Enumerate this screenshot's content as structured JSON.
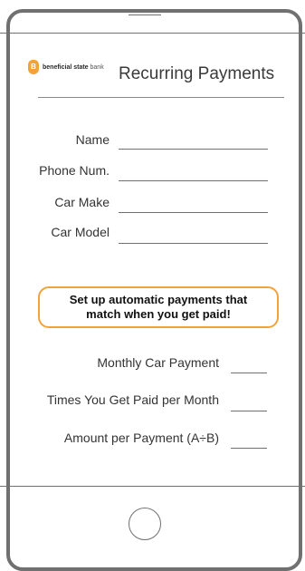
{
  "brand": {
    "name_bold": "beneficial state",
    "name_rest": " bank",
    "logo_letter": "B"
  },
  "title": "Recurring Payments",
  "form": {
    "fields": [
      {
        "label": "Name",
        "value": ""
      },
      {
        "label": "Phone Num.",
        "value": ""
      },
      {
        "label": "Car Make",
        "value": ""
      },
      {
        "label": "Car Model",
        "value": ""
      }
    ]
  },
  "callout": {
    "line1": "Set up automatic payments that",
    "line2": "match when you get paid!"
  },
  "calculation": {
    "rows": [
      {
        "label": "Monthly Car Payment",
        "value": ""
      },
      {
        "label": "Times You Get Paid per Month",
        "value": ""
      },
      {
        "label": "Amount per Payment (A÷B)",
        "value": ""
      }
    ]
  },
  "colors": {
    "accent": "#f1a33a",
    "frame": "#707070"
  },
  "icons": {
    "logo": "acorn-logo-icon",
    "home": "home-button-icon"
  }
}
